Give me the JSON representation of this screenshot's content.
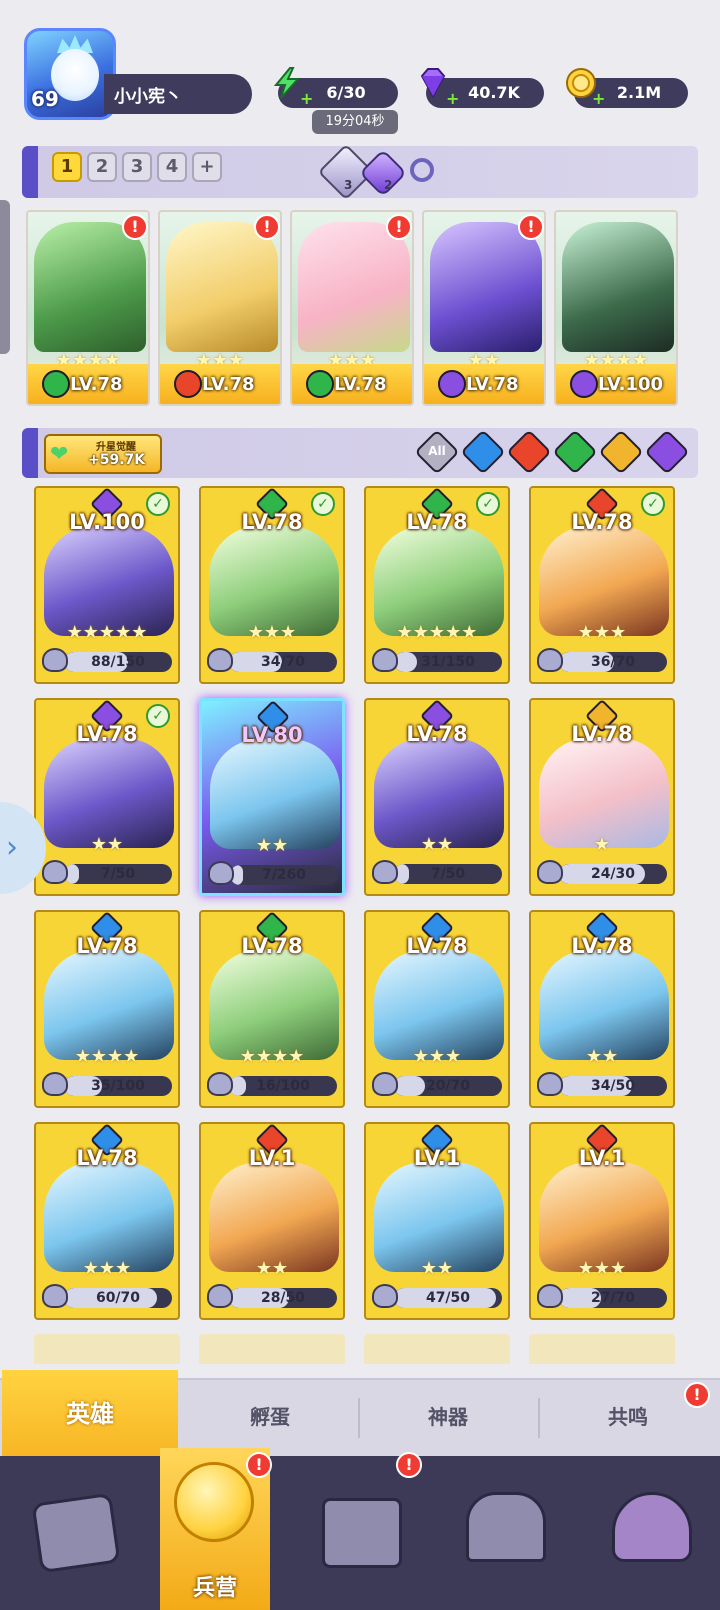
{
  "player": {
    "level": "69",
    "name": "小小宪丶"
  },
  "resources": {
    "energy": "6/30",
    "energy_timer": "19分04秒",
    "gems": "40.7K",
    "gold": "2.1M"
  },
  "team": {
    "tabs": [
      "1",
      "2",
      "3",
      "4",
      "+"
    ],
    "active_tab": "1",
    "item1_count": "3",
    "item2_count": "2"
  },
  "team_slots": [
    {
      "level": "LV.78",
      "stars": "★★★★",
      "element": "green",
      "alert": "!"
    },
    {
      "level": "LV.78",
      "stars": "★★★",
      "element": "red",
      "alert": "!"
    },
    {
      "level": "LV.78",
      "stars": "★★★",
      "element": "green",
      "alert": "!"
    },
    {
      "level": "LV.78",
      "stars": "★★",
      "element": "purple",
      "alert": "!"
    },
    {
      "level": "LV.100",
      "stars": "★★★★",
      "element": "purple",
      "alert": ""
    }
  ],
  "awaken": {
    "label": "升星觉醒",
    "value": "+59.7K"
  },
  "filters": [
    "All",
    "water",
    "fire",
    "wind",
    "light",
    "dark"
  ],
  "filter_all_label": "All",
  "heroes": [
    {
      "level": "LV.100",
      "element": "purple",
      "check": true,
      "stars": "★★★★★",
      "progress": "88/150",
      "fill": 0.59
    },
    {
      "level": "LV.78",
      "element": "green",
      "check": true,
      "stars": "★★★",
      "progress": "34/70",
      "fill": 0.49
    },
    {
      "level": "LV.78",
      "element": "green",
      "check": true,
      "stars": "★★★★★",
      "progress": "31/150",
      "fill": 0.21
    },
    {
      "level": "LV.78",
      "element": "red",
      "check": true,
      "stars": "★★★",
      "progress": "36/70",
      "fill": 0.51
    },
    {
      "level": "LV.78",
      "element": "purple",
      "check": true,
      "stars": "★★",
      "progress": "7/50",
      "fill": 0.14
    },
    {
      "level": "LV.80",
      "element": "blue",
      "check": false,
      "stars": "★★",
      "progress": "7/260",
      "fill": 0.03,
      "selected": true
    },
    {
      "level": "LV.78",
      "element": "purple",
      "check": false,
      "stars": "★★",
      "progress": "7/50",
      "fill": 0.14
    },
    {
      "level": "LV.78",
      "element": "yellow",
      "check": false,
      "stars": "★",
      "progress": "24/30",
      "fill": 0.8
    },
    {
      "level": "LV.78",
      "element": "blue",
      "check": false,
      "stars": "★★★★",
      "progress": "35/100",
      "fill": 0.35
    },
    {
      "level": "LV.78",
      "element": "green",
      "check": false,
      "stars": "★★★★",
      "progress": "16/100",
      "fill": 0.16
    },
    {
      "level": "LV.78",
      "element": "blue",
      "check": false,
      "stars": "★★★",
      "progress": "20/70",
      "fill": 0.29
    },
    {
      "level": "LV.78",
      "element": "blue",
      "check": false,
      "stars": "★★",
      "progress": "34/50",
      "fill": 0.68
    },
    {
      "level": "LV.78",
      "element": "blue",
      "check": false,
      "stars": "★★★",
      "progress": "60/70",
      "fill": 0.86
    },
    {
      "level": "LV.1",
      "element": "red",
      "check": false,
      "stars": "★★",
      "progress": "28/50",
      "fill": 0.56
    },
    {
      "level": "LV.1",
      "element": "blue",
      "check": false,
      "stars": "★★",
      "progress": "47/50",
      "fill": 0.94
    },
    {
      "level": "LV.1",
      "element": "red",
      "check": false,
      "stars": "★★★",
      "progress": "27/70",
      "fill": 0.39
    }
  ],
  "subnav": {
    "heroes": "英雄",
    "hatch": "孵蛋",
    "artifact": "神器",
    "resonance": "共鸣",
    "alert": "!"
  },
  "bottomnav": {
    "barracks": "兵营",
    "alert": "!"
  },
  "colors": {
    "green": "#2fb54a",
    "red": "#e8452b",
    "purple": "#8a4fe0",
    "blue": "#2f8ee8",
    "yellow": "#f0b52c",
    "accent": "#5b4fc7"
  }
}
